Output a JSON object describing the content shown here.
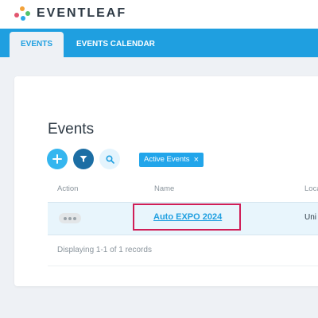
{
  "app": {
    "brand": "EVENTLEAF"
  },
  "tabs": [
    {
      "label": "EVENTS",
      "active": true
    },
    {
      "label": "EVENTS CALENDAR",
      "active": false
    }
  ],
  "main": {
    "title": "Events",
    "filter_chip": {
      "label": "Active Events",
      "close": "×"
    },
    "columns": [
      "Action",
      "Name",
      "Loca"
    ],
    "rows": [
      {
        "action": "•••",
        "name": "Auto EXPO 2024",
        "location": "Uni"
      }
    ],
    "footer": "Displaying 1-1 of 1 records"
  },
  "colors": {
    "accent": "#1f9fe0",
    "dark_action": "#1c6ea4",
    "highlight": "#d01e57",
    "logo_dots": [
      "#f3a23a",
      "#e2566f",
      "#2ea8e7",
      "#53c26b"
    ]
  },
  "icons": [
    "plus-icon",
    "filter-icon",
    "search-icon",
    "close-icon",
    "more-icon"
  ]
}
